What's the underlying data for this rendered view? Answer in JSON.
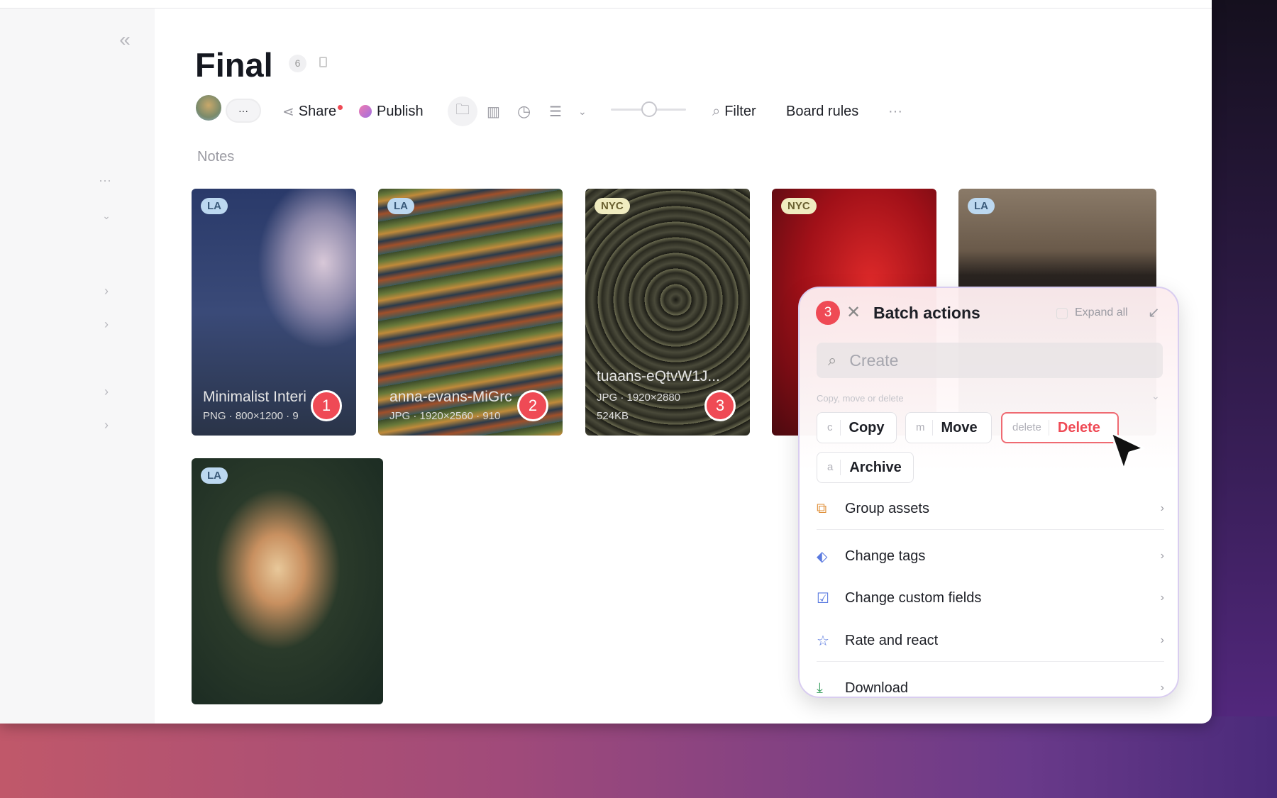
{
  "page": {
    "title": "Final",
    "count": "6",
    "section": "Notes"
  },
  "toolbar": {
    "more_people": "···",
    "share": "Share",
    "publish": "Publish",
    "filter": "Filter",
    "board_rules": "Board rules",
    "more": "···",
    "zoom_slider_percent": 50
  },
  "cards": [
    {
      "tag": "LA",
      "name": "Minimalist Interi",
      "meta": "PNG · 800×1200 · 9",
      "number": "1"
    },
    {
      "tag": "LA",
      "name": "anna-evans-MiGrc",
      "meta": "JPG · 1920×2560 · 910",
      "number": "2"
    },
    {
      "tag": "NYC",
      "name": "tuaans-eQtvW1J...",
      "meta": "JPG · 1920×2880",
      "size": "524KB",
      "number": "3"
    },
    {
      "tag": "NYC"
    },
    {
      "tag": "LA"
    },
    {
      "tag": "LA"
    }
  ],
  "batch": {
    "selected": "3",
    "title": "Batch actions",
    "expand_all": "Expand all",
    "search_placeholder": "Create",
    "section": "Copy, move or delete",
    "buttons": [
      {
        "key": "c",
        "label": "Copy"
      },
      {
        "key": "m",
        "label": "Move"
      },
      {
        "key": "delete",
        "label": "Delete"
      },
      {
        "key": "a",
        "label": "Archive"
      }
    ],
    "items": [
      {
        "label": "Group assets",
        "icon": "group-icon"
      },
      {
        "label": "Change tags",
        "icon": "tag-icon"
      },
      {
        "label": "Change custom fields",
        "icon": "checkbox-icon"
      },
      {
        "label": "Rate and react",
        "icon": "star-icon"
      },
      {
        "label": "Download",
        "icon": "download-icon"
      }
    ]
  },
  "colors": {
    "accent_red": "#ef4a55",
    "delete": "#ef4a55"
  }
}
